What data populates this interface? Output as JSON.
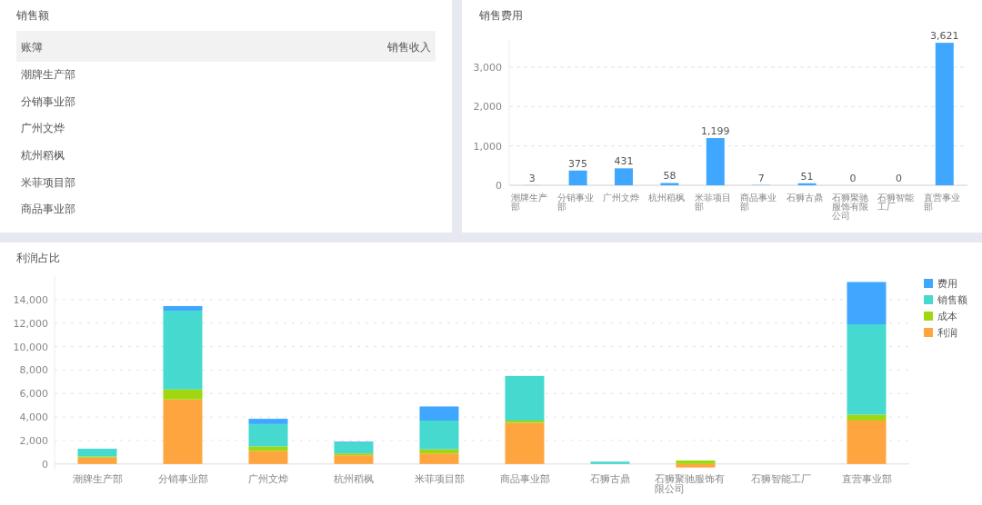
{
  "sales_panel": {
    "title": "销售额",
    "table": {
      "columns": [
        "账簿",
        "销售收入"
      ],
      "rows": [
        {
          "name": "潮牌生产部"
        },
        {
          "name": "分销事业部"
        },
        {
          "name": "广州文烨"
        },
        {
          "name": "杭州稻枫"
        },
        {
          "name": "米菲项目部"
        },
        {
          "name": "商品事业部"
        }
      ]
    }
  },
  "expense_panel": {
    "title": "销售费用",
    "chart_data": {
      "type": "bar",
      "categories": [
        "潮牌生产部",
        "分销事业部",
        "广州文烨",
        "杭州稻枫",
        "米菲项目部",
        "商品事业部",
        "石狮古鼎",
        "石狮聚驰服饰有限公司",
        "石狮智能工厂",
        "直营事业部"
      ],
      "values": [
        3,
        375,
        431,
        58,
        1199,
        7,
        51,
        0,
        0,
        3621
      ],
      "ylim": [
        0,
        3700
      ],
      "yticks": [
        {
          "value": 0,
          "label": "0"
        },
        {
          "value": 1000,
          "label": "1,000"
        },
        {
          "value": 2000,
          "label": "2,000"
        },
        {
          "value": 3000,
          "label": "3,000"
        }
      ],
      "grid": true,
      "data_labels": true,
      "value_labels": [
        "3",
        "375",
        "431",
        "58",
        "1,199",
        "7",
        "51",
        "0",
        "0",
        "3,621"
      ],
      "color": "#3fa7ff"
    }
  },
  "profit_panel": {
    "title": "利润占比",
    "chart_data": {
      "type": "bar",
      "stacked": true,
      "grid": true,
      "legend": true,
      "ylim": [
        -500,
        16000
      ],
      "categories": [
        "潮牌生产部",
        "分销事业部",
        "广州文烨",
        "杭州稻枫",
        "米菲项目部",
        "商品事业部",
        "石狮古鼎",
        "石狮聚驰服饰有限公司",
        "石狮智能工厂",
        "直营事业部"
      ],
      "yticks": [
        {
          "value": 0,
          "label": "0"
        },
        {
          "value": 2000,
          "label": "2,000"
        },
        {
          "value": 4000,
          "label": "4,000"
        },
        {
          "value": 6000,
          "label": "6,000"
        },
        {
          "value": 8000,
          "label": "8,000"
        },
        {
          "value": 10000,
          "label": "10,000"
        },
        {
          "value": 12000,
          "label": "12,000"
        },
        {
          "value": 14000,
          "label": "14,000"
        }
      ],
      "series": [
        {
          "name": "利润",
          "color": "#ffa53f",
          "values": [
            550,
            5500,
            1100,
            750,
            900,
            3500,
            0,
            -300,
            0,
            3700
          ]
        },
        {
          "name": "成本",
          "color": "#9fd811",
          "values": [
            100,
            850,
            400,
            150,
            350,
            200,
            0,
            300,
            0,
            500
          ]
        },
        {
          "name": "销售额",
          "color": "#45d9cf",
          "values": [
            650,
            6700,
            1900,
            950,
            2450,
            3800,
            200,
            0,
            0,
            7700
          ]
        },
        {
          "name": "费用",
          "color": "#3fa7ff",
          "values": [
            0,
            400,
            450,
            50,
            1200,
            0,
            null,
            0,
            0,
            3600
          ]
        }
      ]
    }
  }
}
